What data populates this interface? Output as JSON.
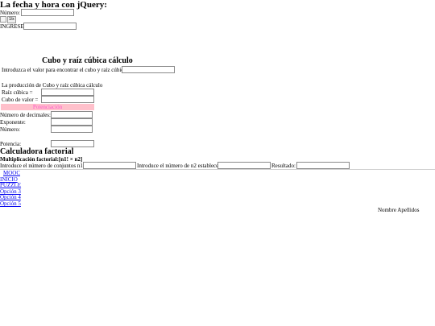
{
  "fecha": {
    "title": "La fecha y hora con jQuery:",
    "numero_label": "Número:",
    "numero_value": "",
    "button_label": "1/x",
    "ingrese_label": "INGRESE",
    "ingrese_value": ""
  },
  "cubo": {
    "title": "Cubo y raíz cúbica cálculo",
    "input_label": "Introduzca el valor para encontrar el cubo y raíz cúbica",
    "input_value": "",
    "production_label": "La producción de Cubo y raíz cúbica cálculo",
    "raiz_label": "Raíz cúbica =",
    "raiz_value": "",
    "cubo_label": "Cubo de valor =",
    "cubo_value": ""
  },
  "potencia": {
    "bar_label": "Potenciación",
    "decimales_label": "Número de decimales:",
    "decimales_value": "",
    "exponente_label": "Exponente:",
    "exponente_value": "",
    "numero_label": "Número:",
    "numero_value": "",
    "resultado_label": "Potencia:",
    "resultado_value": "",
    "bar_color": "#ffc0cb",
    "bar_text_color": "#ff55cc"
  },
  "factorial": {
    "title": "Calculadora factorial",
    "subtitle": "Multiplicación factorial:[n1! × n2]",
    "n1_label": "Introduce el número de conjuntos n1:",
    "n1_value": "",
    "n2_label": "Introduce el número de n2 establece:",
    "n2_value": "",
    "resultado_label": "Resultado:",
    "resultado_value": ""
  },
  "menu": {
    "items": [
      "MOOC",
      "INICIO",
      "PUZZLE",
      "Opción 3",
      "Opción 4",
      "Opción 5"
    ]
  },
  "footer": {
    "name": "Nombre Apellidos"
  }
}
